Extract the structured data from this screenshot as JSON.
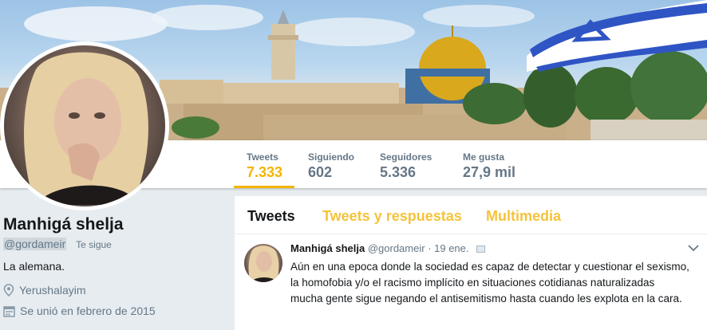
{
  "stats": [
    {
      "label": "Tweets",
      "value": "7.333",
      "active": true
    },
    {
      "label": "Siguiendo",
      "value": "602",
      "active": false
    },
    {
      "label": "Seguidores",
      "value": "5.336",
      "active": false
    },
    {
      "label": "Me gusta",
      "value": "27,9 mil",
      "active": false
    }
  ],
  "profile": {
    "name": "Manhigá shelja",
    "handle": "@gordameir",
    "follows_you": "Te sigue",
    "bio": "La alemana.",
    "location": "Yerushalayim",
    "joined": "Se unió en febrero de 2015"
  },
  "tabs": [
    "Tweets",
    "Tweets y respuestas",
    "Multimedia"
  ],
  "tweet": {
    "name": "Manhigá shelja",
    "handle": "@gordameir",
    "date": "· 19 ene.",
    "text": "Aún en una epoca donde la sociedad es capaz de detectar y cuestionar el sexismo, la homofobia y/o el racismo implícito en situaciones cotidianas naturalizadas mucha gente sigue negando el antisemitismo hasta cuando les explota en la cara."
  },
  "colors": {
    "accent": "#f5b400",
    "tab_inactive": "#f5c33a",
    "secondary": "#657786"
  },
  "icons": [
    "location-pin-icon",
    "calendar-icon",
    "chevron-down-icon",
    "link-card-icon"
  ]
}
